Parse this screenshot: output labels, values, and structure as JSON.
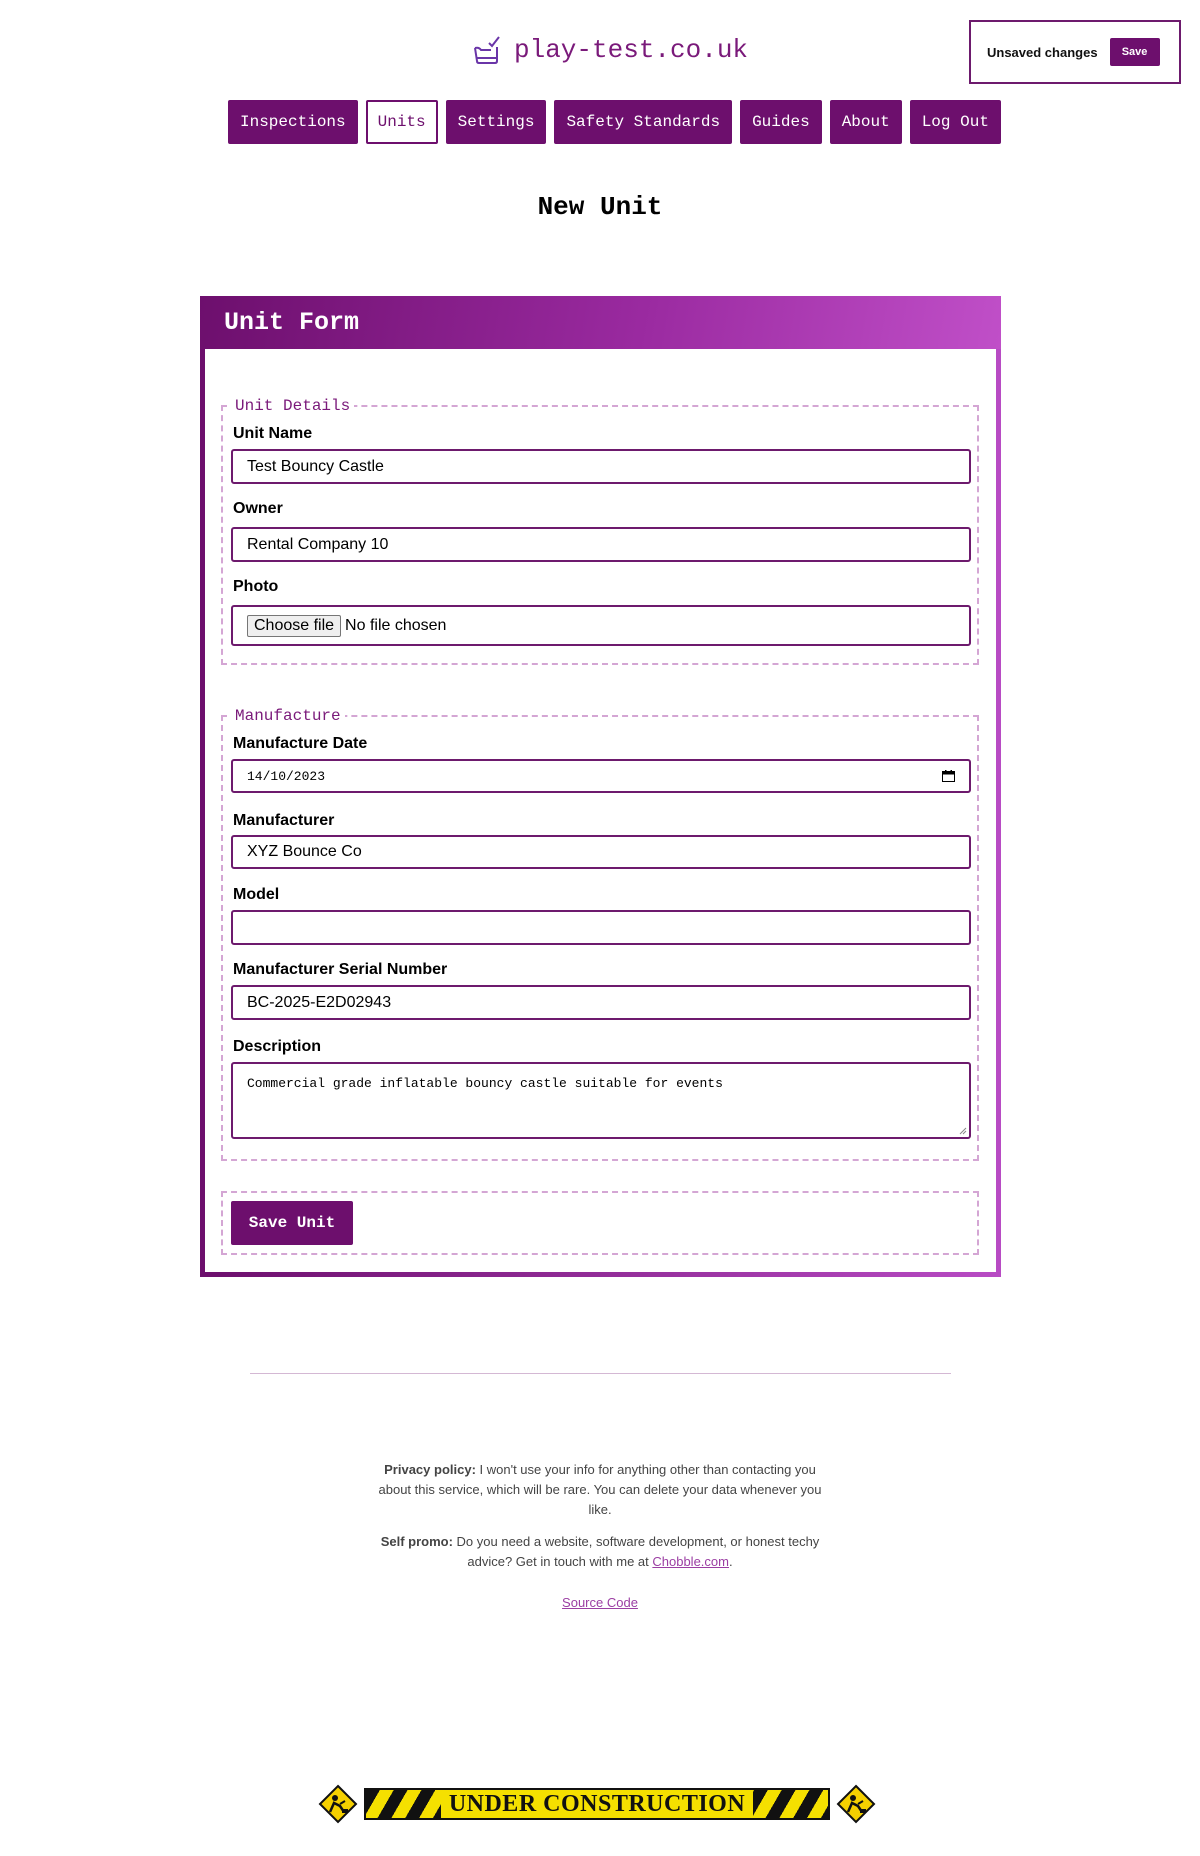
{
  "site": {
    "title": "play-test.co.uk"
  },
  "unsaved": {
    "text": "Unsaved changes",
    "save_label": "Save"
  },
  "nav": [
    {
      "label": "Inspections",
      "active": false
    },
    {
      "label": "Units",
      "active": true
    },
    {
      "label": "Settings",
      "active": false
    },
    {
      "label": "Safety Standards",
      "active": false
    },
    {
      "label": "Guides",
      "active": false
    },
    {
      "label": "About",
      "active": false
    },
    {
      "label": "Log Out",
      "active": false
    }
  ],
  "page": {
    "title": "New Unit"
  },
  "form": {
    "header": "Unit Form",
    "unit_details": {
      "legend": "Unit Details",
      "unit_name": {
        "label": "Unit Name",
        "value": "Test Bouncy Castle"
      },
      "owner": {
        "label": "Owner",
        "value": "Rental Company 10"
      },
      "photo": {
        "label": "Photo",
        "button": "Choose file",
        "status": "No file chosen"
      }
    },
    "manufacture": {
      "legend": "Manufacture",
      "date": {
        "label": "Manufacture Date",
        "value": "14/10/2023"
      },
      "manufacturer": {
        "label": "Manufacturer",
        "value": "XYZ Bounce Co"
      },
      "model": {
        "label": "Model",
        "value": ""
      },
      "serial": {
        "label": "Manufacturer Serial Number",
        "value": "BC-2025-E2D02943"
      },
      "description": {
        "label": "Description",
        "value": "Commercial grade inflatable bouncy castle suitable for events"
      }
    },
    "submit_label": "Save Unit"
  },
  "footer": {
    "privacy_heading": "Privacy policy:",
    "privacy_text": " I won't use your info for anything other than contacting you about this service, which will be rare. You can delete your data whenever you like.",
    "promo_heading": "Self promo:",
    "promo_text": " Do you need a website, software development, or honest techy advice? Get in touch with me at ",
    "promo_link": "Chobble.com",
    "promo_end": ".",
    "source_link": "Source Code"
  },
  "construction": {
    "text": "UNDER CONSTRUCTION"
  },
  "colors": {
    "brand": "#6d0f6d",
    "accent_light": "#c04fc8",
    "link": "#9b3ea3"
  }
}
